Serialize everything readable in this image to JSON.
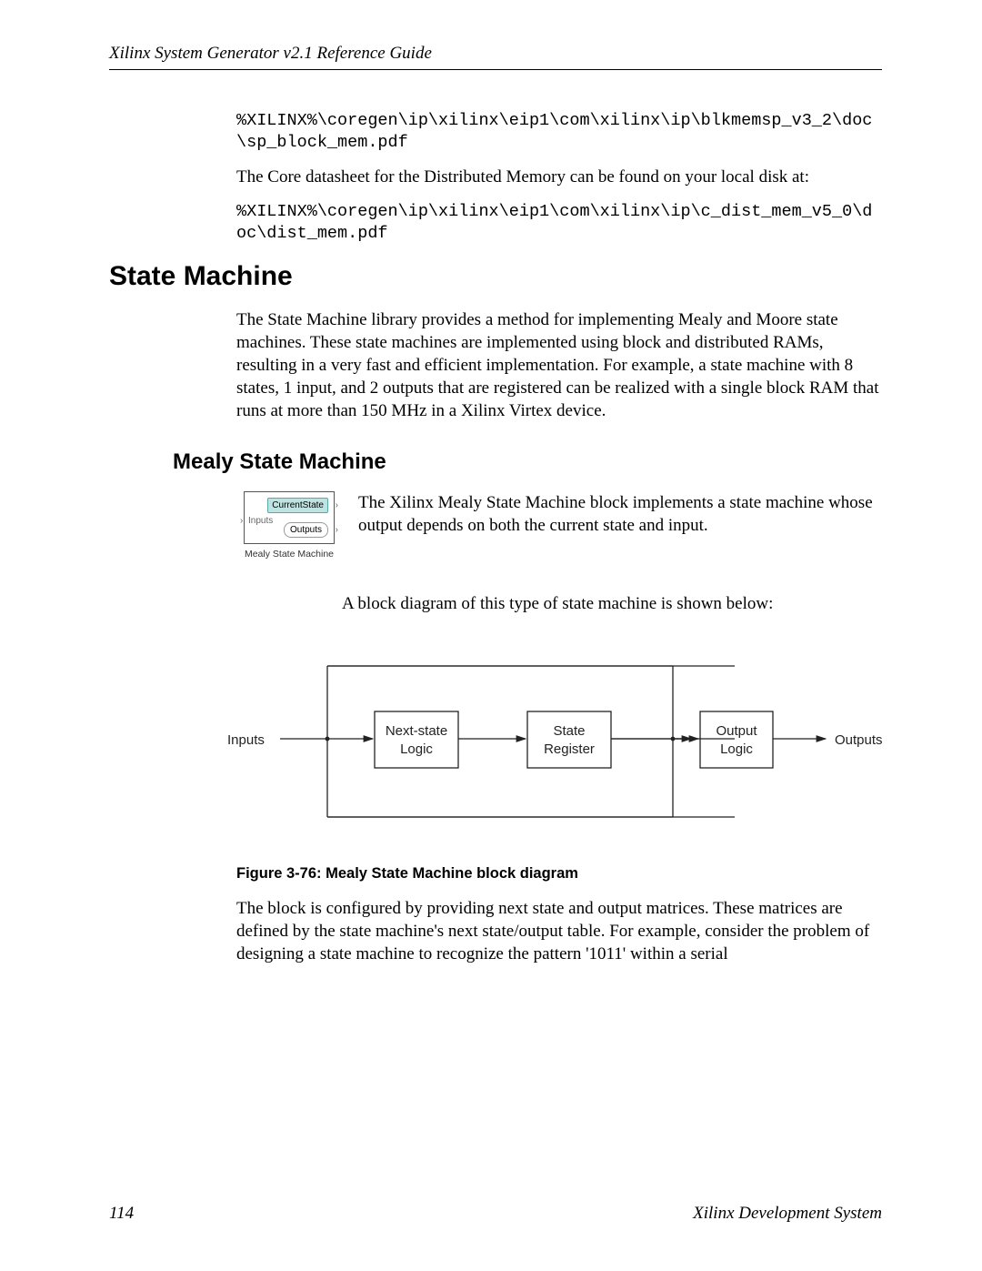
{
  "header": {
    "running": "Xilinx System Generator v2.1 Reference Guide"
  },
  "code1": "%XILINX%\\coregen\\ip\\xilinx\\eip1\\com\\xilinx\\ip\\blkmemsp_v3_2\\doc\\sp_block_mem.pdf",
  "para1": "The Core datasheet for the Distributed Memory can be found on your local disk at:",
  "code2": "%XILINX%\\coregen\\ip\\xilinx\\eip1\\com\\xilinx\\ip\\c_dist_mem_v5_0\\doc\\dist_mem.pdf",
  "h1": "State Machine",
  "para2": "The State Machine library provides a method for implementing Mealy and Moore state machines. These state machines are implemented using block and distributed RAMs, resulting in a very fast and efficient implementation. For example, a state machine with 8 states, 1 input, and 2 outputs that are registered can be realized with a single block RAM that runs at more than 150 MHz in a Xilinx Virtex device.",
  "h2": "Mealy State Machine",
  "mealy_icon": {
    "current_state": "CurrentState",
    "inputs": "Inputs",
    "outputs": "Outputs",
    "caption": "Mealy State Machine"
  },
  "mealy_para": "The Xilinx Mealy State Machine block implements a state machine whose output depends on both the current state and input.",
  "diagram_lead": "A block diagram of this type of state machine is shown below:",
  "diagram": {
    "inputs_label": "Inputs",
    "outputs_label": "Outputs",
    "box1_l1": "Next-state",
    "box1_l2": "Logic",
    "box2_l1": "State",
    "box2_l2": "Register",
    "box3_l1": "Output",
    "box3_l2": "Logic"
  },
  "fig_caption": "Figure 3-76:   Mealy State Machine block diagram",
  "para3": "The block is configured by providing next state and output matrices.  These matrices are defined by the state machine's next state/output table.  For example, consider the problem of designing a state machine to recognize the pattern '1011' within a serial",
  "footer": {
    "page": "114",
    "right": "Xilinx Development System"
  }
}
